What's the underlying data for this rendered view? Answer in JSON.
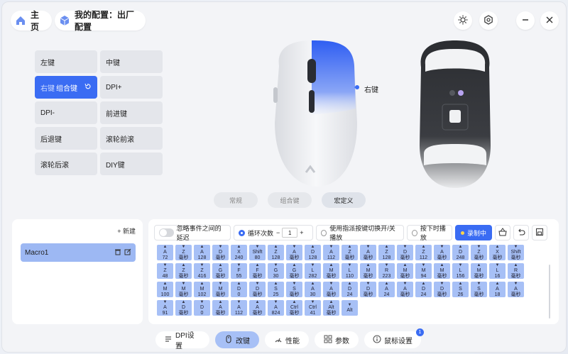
{
  "header": {
    "home_label": "主页",
    "config_label": "我的配置：出厂配置"
  },
  "keys": [
    {
      "label": "左键",
      "sub": "",
      "active": false
    },
    {
      "label": "中键",
      "sub": "",
      "active": false
    },
    {
      "label": "右键",
      "sub": "组合键",
      "active": true
    },
    {
      "label": "DPI+",
      "sub": "",
      "active": false
    },
    {
      "label": "DPI-",
      "sub": "",
      "active": false
    },
    {
      "label": "前进键",
      "sub": "",
      "active": false
    },
    {
      "label": "后退键",
      "sub": "",
      "active": false
    },
    {
      "label": "滚轮前滚",
      "sub": "",
      "active": false
    },
    {
      "label": "滚轮后滚",
      "sub": "",
      "active": false
    },
    {
      "label": "DIY键",
      "sub": "",
      "active": false
    }
  ],
  "mouse": {
    "callout_label": "右键"
  },
  "mode_tabs": [
    {
      "label": "常规",
      "active": false
    },
    {
      "label": "组合键",
      "active": false
    },
    {
      "label": "宏定义",
      "active": true
    }
  ],
  "macro_list": {
    "new_label": "+ 新建",
    "items": [
      "Macro1"
    ]
  },
  "macro_editor": {
    "ignore_delay_label": "忽略事件之间的延迟",
    "loop_label": "循环次数",
    "loop_value": "1",
    "toggle_label": "使用指派按键切换开/关播放",
    "hold_label": "按下时播放",
    "record_label": "录制中",
    "rows": [
      [
        [
          "A",
          "72"
        ],
        [
          "Z",
          "毫秒"
        ],
        [
          "A",
          "128"
        ],
        [
          "D",
          "毫秒"
        ],
        [
          "X",
          "240"
        ],
        [
          "Shift",
          "80"
        ],
        [
          "Z",
          "128"
        ],
        [
          "A",
          "毫秒"
        ],
        [
          "D",
          "128"
        ],
        [
          "A",
          "112"
        ],
        [
          "Z",
          "毫秒"
        ],
        [
          "A",
          "毫秒"
        ],
        [
          "Z",
          "128"
        ],
        [
          "D",
          "毫秒"
        ],
        [
          "Z",
          "112"
        ],
        [
          "A",
          "毫秒"
        ],
        [
          "D",
          "248"
        ],
        [
          "Z",
          "毫秒"
        ],
        [
          "X",
          "毫秒"
        ],
        [
          "Shift",
          "毫秒"
        ]
      ],
      [
        [
          "Z",
          "48"
        ],
        [
          "Z",
          "毫秒"
        ],
        [
          "Z",
          "416"
        ],
        [
          "G",
          "毫秒"
        ],
        [
          "F",
          "55"
        ],
        [
          "F",
          "毫秒"
        ],
        [
          "G",
          "30"
        ],
        [
          "G",
          "毫秒"
        ],
        [
          "L",
          "282"
        ],
        [
          "M",
          "毫秒"
        ],
        [
          "L",
          "110"
        ],
        [
          "M",
          "毫秒"
        ],
        [
          "R",
          "223"
        ],
        [
          "M",
          "毫秒"
        ],
        [
          "M",
          "94"
        ],
        [
          "M",
          "毫秒"
        ],
        [
          "L",
          "156"
        ],
        [
          "M",
          "毫秒"
        ],
        [
          "L",
          "16"
        ],
        [
          "R",
          "毫秒"
        ]
      ],
      [
        [
          "M",
          "100"
        ],
        [
          "M",
          "毫秒"
        ],
        [
          "M",
          "102"
        ],
        [
          "M",
          "毫秒"
        ],
        [
          "D",
          "0"
        ],
        [
          "D",
          "毫秒"
        ],
        [
          "S",
          "25"
        ],
        [
          "S",
          "毫秒"
        ],
        [
          "A",
          "30"
        ],
        [
          "A",
          "毫秒"
        ],
        [
          "D",
          "24"
        ],
        [
          "D",
          "毫秒"
        ],
        [
          "A",
          "24"
        ],
        [
          "A",
          "毫秒"
        ],
        [
          "D",
          "24"
        ],
        [
          "D",
          "毫秒"
        ],
        [
          "S",
          "26"
        ],
        [
          "S",
          "毫秒"
        ],
        [
          "A",
          "18"
        ],
        [
          "A",
          "毫秒"
        ]
      ],
      [
        [
          "A",
          "91"
        ],
        [
          "D",
          "毫秒"
        ],
        [
          "D",
          "0"
        ],
        [
          "A",
          "毫秒"
        ],
        [
          "A",
          "112"
        ],
        [
          "A",
          "毫秒"
        ],
        [
          "A",
          "824"
        ],
        [
          "Ctrl",
          "毫秒"
        ],
        [
          "Ctrl",
          "41"
        ],
        [
          "Alt",
          "毫秒"
        ],
        [
          "Alt",
          ""
        ]
      ]
    ]
  },
  "bottom_nav": [
    {
      "label": "DPI设置",
      "active": false,
      "icon": "dpi-icon"
    },
    {
      "label": "改键",
      "active": true,
      "icon": "mouse-icon"
    },
    {
      "label": "性能",
      "active": false,
      "icon": "performance-icon"
    },
    {
      "label": "参数",
      "active": false,
      "icon": "grid-icon"
    },
    {
      "label": "鼠标设置",
      "active": false,
      "icon": "info-icon",
      "badge": "1"
    }
  ],
  "colors": {
    "accent": "#3a6cf3",
    "macro_cell": "#a7c0f6"
  }
}
